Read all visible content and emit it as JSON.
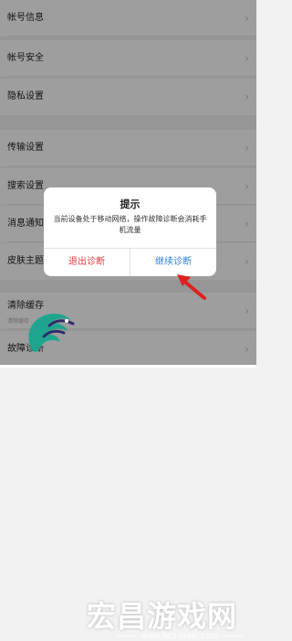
{
  "settings": {
    "items": [
      {
        "label": "帐号信息"
      },
      {
        "label": "帐号安全"
      },
      {
        "label": "隐私设置"
      },
      {
        "label": "传输设置"
      },
      {
        "label": "搜索设置"
      },
      {
        "label": "消息通知"
      },
      {
        "label": "皮肤主题"
      },
      {
        "label": "清除缓存",
        "sub": "清除缓存"
      },
      {
        "label": "故障诊断"
      }
    ],
    "chevron": "›"
  },
  "dialog": {
    "title": "提示",
    "message": "当前设备处于移动网络，操作故障诊断会消耗手机流量",
    "exit_label": "退出诊断",
    "continue_label": "继续诊断",
    "exit_color": "#e23b3b",
    "continue_color": "#2f82d9"
  },
  "watermark": {
    "text": "宏昌游戏网",
    "url": "www.hcs-laser.com"
  }
}
